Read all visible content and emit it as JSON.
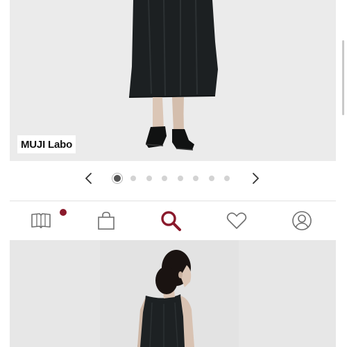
{
  "gallery": {
    "brand_label": "MUJI Labo",
    "slide_count": 8,
    "active_slide": 1
  },
  "bottom_nav": {
    "items": [
      {
        "icon": "catalog-book-icon",
        "has_badge": true
      },
      {
        "icon": "shopping-bag-icon",
        "has_badge": false
      },
      {
        "icon": "search-icon",
        "active": true
      },
      {
        "icon": "heart-icon",
        "has_badge": false
      },
      {
        "icon": "account-icon",
        "has_badge": false
      }
    ],
    "active_color": "#8a1a2c",
    "inactive_color": "#777777"
  }
}
